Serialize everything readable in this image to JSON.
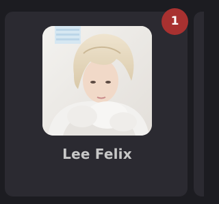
{
  "card": {
    "name": "Lee Felix",
    "badge_count": "1",
    "avatar_icon": "person-photo"
  },
  "colors": {
    "background": "#1c1c21",
    "card": "#2b2a31",
    "badge": "#a83130",
    "name_text": "#c8c8c8"
  }
}
